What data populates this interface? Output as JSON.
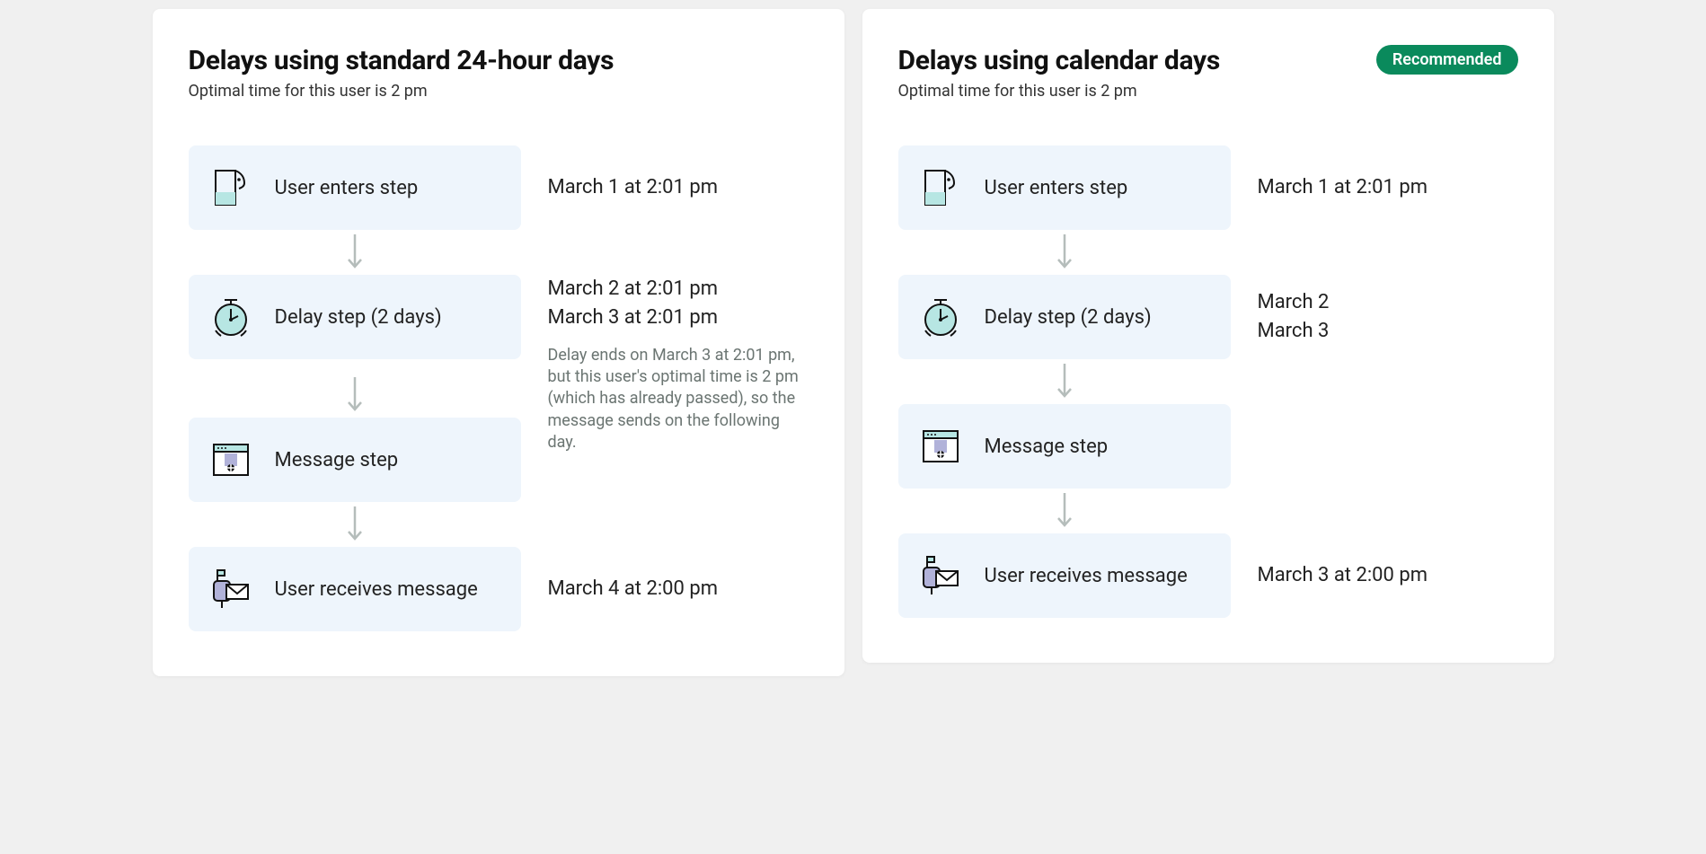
{
  "panels": [
    {
      "title": "Delays using standard 24-hour days",
      "subtitle": "Optimal time for this user is 2 pm",
      "badge": null,
      "steps": [
        {
          "icon": "user",
          "label": "User enters step",
          "right": [
            "March 1 at 2:01 pm"
          ],
          "note": null
        },
        {
          "icon": "clock",
          "label": "Delay step (2 days)",
          "right": [
            "March 2 at 2:01 pm",
            "March 3 at 2:01 pm"
          ],
          "note": "Delay ends on March 3 at 2:01 pm, but this user's optimal time is 2 pm (which has already passed), so the message sends on the following day."
        },
        {
          "icon": "window",
          "label": "Message step",
          "right": [],
          "note": null
        },
        {
          "icon": "mailbox",
          "label": "User receives message",
          "right": [
            "March 4 at 2:00 pm"
          ],
          "note": null
        }
      ]
    },
    {
      "title": "Delays using calendar days",
      "subtitle": "Optimal time for this user is 2 pm",
      "badge": "Recommended",
      "steps": [
        {
          "icon": "user",
          "label": "User enters step",
          "right": [
            "March 1 at 2:01 pm"
          ],
          "note": null
        },
        {
          "icon": "clock",
          "label": "Delay step (2 days)",
          "right": [
            "March 2",
            "March 3"
          ],
          "note": null
        },
        {
          "icon": "window",
          "label": "Message step",
          "right": [],
          "note": null
        },
        {
          "icon": "mailbox",
          "label": "User receives message",
          "right": [
            "March 3 at 2:00 pm"
          ],
          "note": null
        }
      ]
    }
  ]
}
